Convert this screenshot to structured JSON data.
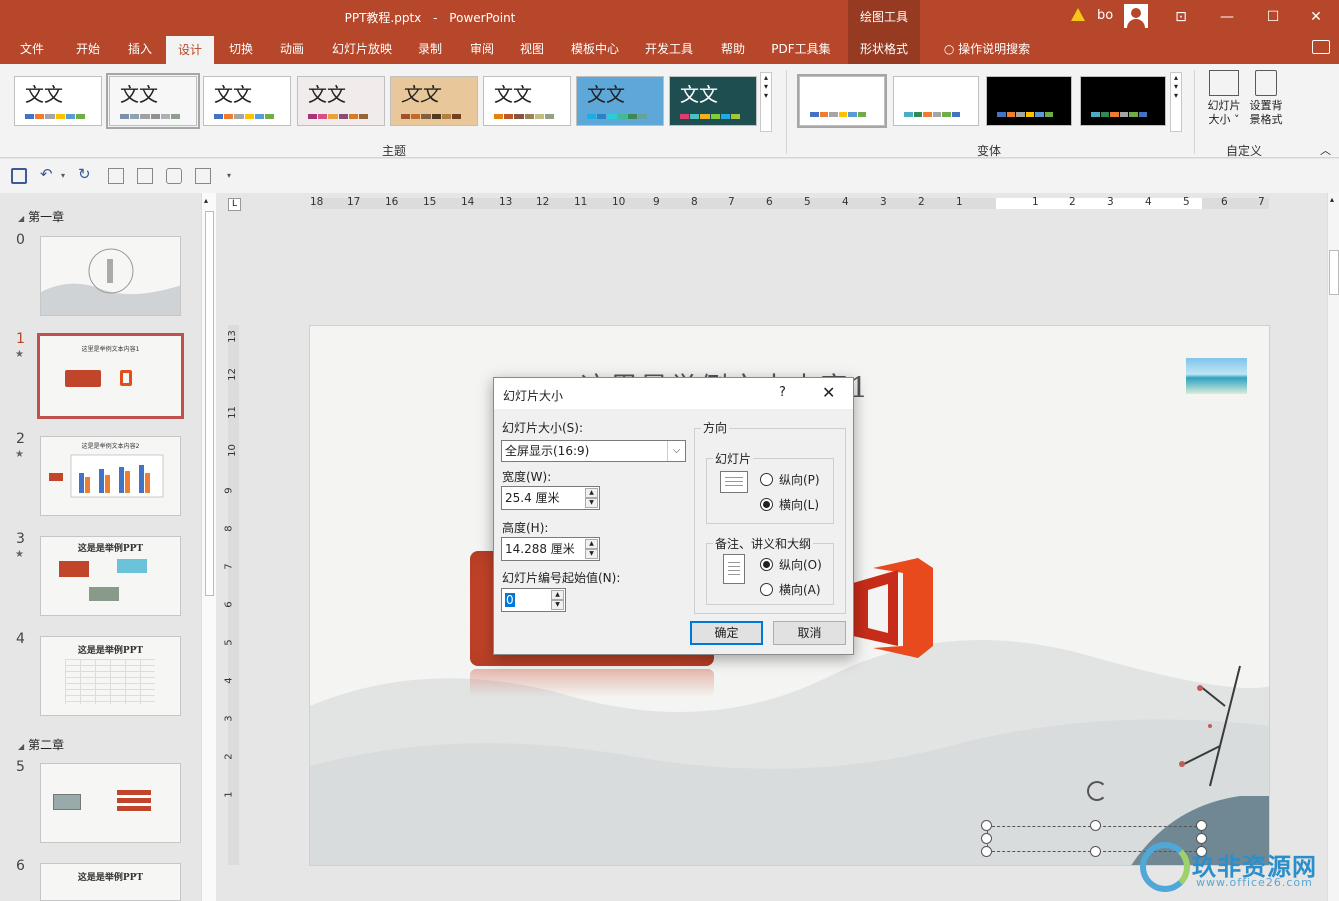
{
  "window": {
    "title_file": "PPT教程.pptx",
    "title_sep": "-",
    "title_app": "PowerPoint",
    "context_tool": "绘图工具",
    "user": "bo"
  },
  "tabs": [
    "文件",
    "开始",
    "插入",
    "设计",
    "切换",
    "动画",
    "幻灯片放映",
    "录制",
    "审阅",
    "视图",
    "模板中心",
    "开发工具",
    "帮助",
    "PDF工具集",
    "形状格式"
  ],
  "search_hint": "操作说明搜索",
  "ribbon": {
    "theme_sample_text": "文文",
    "theme_group_label": "主题",
    "variant_group_label": "变体",
    "custom_group_label": "自定义",
    "slide_size_label_1": "幻灯片",
    "slide_size_label_2": "大小 ˅",
    "bg_format_label_1": "设置背",
    "bg_format_label_2": "景格式"
  },
  "slide_panel": {
    "section1": "第一章",
    "section2": "第二章",
    "slide_numbers": [
      "0",
      "1",
      "2",
      "3",
      "4",
      "5",
      "6"
    ],
    "thumb1_title": "这里是举例文本内容1",
    "thumb2_title": "这是是举例文本内容2",
    "thumb3_title": "这是是举例PPT",
    "thumb4_title": "这是是举例PPT",
    "thumb6_title": "这是是举例PPT",
    "star": "★"
  },
  "ruler": {
    "h_numbers": [
      "18",
      "17",
      "16",
      "15",
      "14",
      "13",
      "12",
      "11",
      "10",
      "9",
      "8",
      "7",
      "6",
      "5",
      "4",
      "3",
      "2",
      "1",
      "1",
      "2",
      "3",
      "4",
      "5",
      "6",
      "7"
    ],
    "v_numbers": [
      "13",
      "12",
      "11",
      "10",
      "9",
      "8",
      "7",
      "6",
      "5",
      "4",
      "3",
      "2",
      "1"
    ],
    "corner": "L"
  },
  "slide": {
    "title": "这里是举例文本内容1"
  },
  "dialog": {
    "title": "幻灯片大小",
    "help": "?",
    "close": "✕",
    "size_label": "幻灯片大小(S):",
    "size_value": "全屏显示(16:9)",
    "width_label": "宽度(W):",
    "width_value": "25.4 厘米",
    "height_label": "高度(H):",
    "height_value": "14.288 厘米",
    "start_num_label": "幻灯片编号起始值(N):",
    "start_num_value": "0",
    "orientation_label": "方向",
    "slides_group": "幻灯片",
    "slides_portrait": "纵向(P)",
    "slides_landscape": "横向(L)",
    "notes_group": "备注、讲义和大纲",
    "notes_portrait": "纵向(O)",
    "notes_landscape": "横向(A)",
    "ok": "确定",
    "cancel": "取消"
  },
  "watermark": {
    "brand": "玖非资源网",
    "url": "www.office26.com"
  },
  "colors": {
    "accent": "#b7472a",
    "dialog_focus": "#0078d7"
  }
}
